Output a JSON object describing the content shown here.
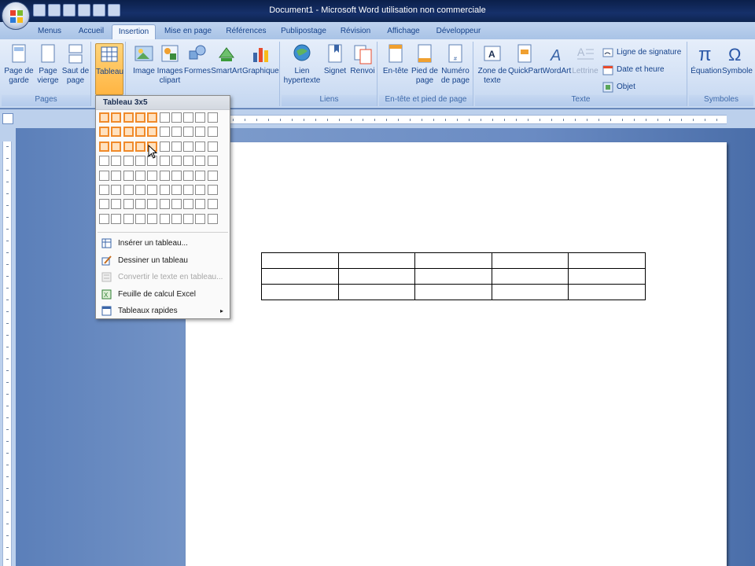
{
  "window": {
    "title": "Document1 - Microsoft Word utilisation non commerciale"
  },
  "tabs": [
    "Menus",
    "Accueil",
    "Insertion",
    "Mise en page",
    "Références",
    "Publipostage",
    "Révision",
    "Affichage",
    "Développeur"
  ],
  "active_tab": "Insertion",
  "ribbon": {
    "pages": {
      "label": "Pages",
      "page_garde": "Page de garde",
      "page_vierge": "Page vierge",
      "saut_page": "Saut de page"
    },
    "tableau": {
      "label": "Tableau"
    },
    "illustrations": {
      "image": "Image",
      "images_clipart": "Images clipart",
      "formes": "Formes",
      "smartart": "SmartArt",
      "graphique": "Graphique"
    },
    "liens": {
      "label": "Liens",
      "lien": "Lien hypertexte",
      "signet": "Signet",
      "renvoi": "Renvoi"
    },
    "entete": {
      "label": "En-tête et pied de page",
      "entete": "En-tête",
      "pied": "Pied de page",
      "numero": "Numéro de page"
    },
    "texte": {
      "label": "Texte",
      "zone": "Zone de texte",
      "quickpart": "QuickPart",
      "wordart": "WordArt",
      "lettrine": "Lettrine",
      "signature": "Ligne de signature",
      "date": "Date et heure",
      "objet": "Objet"
    },
    "symboles": {
      "label": "Symboles",
      "equation": "Équation",
      "symbole": "Symbole"
    }
  },
  "table_menu": {
    "title": "Tableau 3x5",
    "grid_cols": 10,
    "grid_rows": 8,
    "selected_cols": 5,
    "selected_rows": 3,
    "items": [
      {
        "label": "Insérer un tableau...",
        "icon": "insert-table-icon",
        "disabled": false
      },
      {
        "label": "Dessiner un tableau",
        "icon": "draw-table-icon",
        "disabled": false
      },
      {
        "label": "Convertir le texte en tableau...",
        "icon": "convert-text-icon",
        "disabled": true
      },
      {
        "label": "Feuille de calcul Excel",
        "icon": "excel-icon",
        "disabled": false
      },
      {
        "label": "Tableaux rapides",
        "icon": "quick-tables-icon",
        "disabled": false
      }
    ],
    "submenu_arrow": "▸"
  },
  "document": {
    "table_rows": 3,
    "table_cols": 5
  },
  "colors": {
    "accent": "#f08a2a",
    "ribbon": "#d3e1f5",
    "titlebar": "#16306a"
  }
}
